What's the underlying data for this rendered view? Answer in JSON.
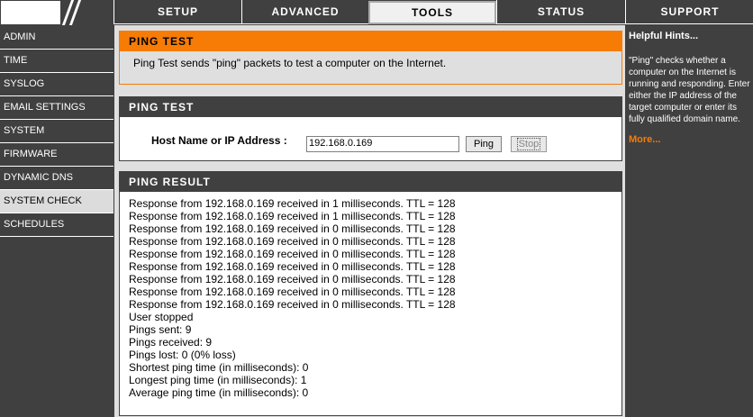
{
  "nav_tabs": [
    "SETUP",
    "ADVANCED",
    "TOOLS",
    "STATUS",
    "SUPPORT"
  ],
  "sidebar": {
    "items": [
      {
        "label": "ADMIN"
      },
      {
        "label": "TIME"
      },
      {
        "label": "SYSLOG"
      },
      {
        "label": "EMAIL SETTINGS"
      },
      {
        "label": "SYSTEM"
      },
      {
        "label": "FIRMWARE"
      },
      {
        "label": "DYNAMIC DNS"
      },
      {
        "label": "SYSTEM CHECK"
      },
      {
        "label": "SCHEDULES"
      }
    ]
  },
  "intro": {
    "title": "PING TEST",
    "description": "Ping Test sends \"ping\" packets to test a computer on the Internet."
  },
  "ping_test": {
    "title": "PING TEST",
    "host_label": "Host Name or IP Address :",
    "host_value": "192.168.0.169",
    "ping_button": "Ping",
    "stop_button": "Stop"
  },
  "ping_result": {
    "title": "PING RESULT",
    "lines": [
      "Response from 192.168.0.169 received in 1 milliseconds. TTL = 128",
      "Response from 192.168.0.169 received in 1 milliseconds. TTL = 128",
      "Response from 192.168.0.169 received in 0 milliseconds. TTL = 128",
      "Response from 192.168.0.169 received in 0 milliseconds. TTL = 128",
      "Response from 192.168.0.169 received in 0 milliseconds. TTL = 128",
      "Response from 192.168.0.169 received in 0 milliseconds. TTL = 128",
      "Response from 192.168.0.169 received in 0 milliseconds. TTL = 128",
      "Response from 192.168.0.169 received in 0 milliseconds. TTL = 128",
      "Response from 192.168.0.169 received in 0 milliseconds. TTL = 128",
      "User stopped",
      "Pings sent: 9",
      "Pings received: 9",
      "Pings lost: 0 (0% loss)",
      "Shortest ping time (in milliseconds): 0",
      "Longest ping time (in milliseconds): 1",
      "Average ping time (in milliseconds): 0"
    ]
  },
  "hints": {
    "title": "Helpful Hints...",
    "text": "\"Ping\" checks whether a computer on the Internet is running and responding. Enter either the IP address of the target computer or enter its fully qualified domain name.",
    "more": "More..."
  },
  "colors": {
    "accent": "#f67c06",
    "dark": "#404040",
    "panel": "#dfdfdf"
  }
}
